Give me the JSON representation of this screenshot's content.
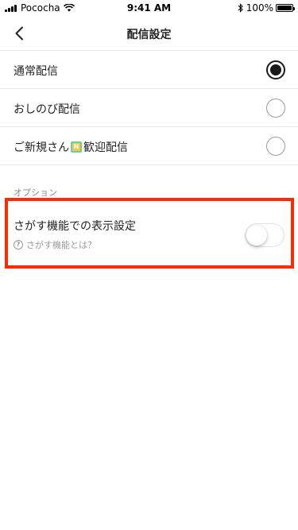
{
  "status_bar": {
    "carrier": "Pococha",
    "time": "9:41 AM",
    "battery": "100%"
  },
  "nav": {
    "back_icon": "chevron-left-icon",
    "title": "配信設定"
  },
  "broadcast_modes": [
    {
      "label": "通常配信",
      "selected": true
    },
    {
      "label": "おしのび配信",
      "selected": false
    },
    {
      "label_prefix": "ご新規さん",
      "badge": "N",
      "label_suffix": "歓迎配信",
      "selected": false
    }
  ],
  "options": {
    "section_header": "オプション",
    "search_display": {
      "title": "さがす機能での表示設定",
      "help_text": "さがす機能とは？",
      "enabled": false
    }
  },
  "colors": {
    "highlight": "#ff2a00",
    "badge_outer": "#6fcf97",
    "badge_inner": "#f2c94c"
  }
}
